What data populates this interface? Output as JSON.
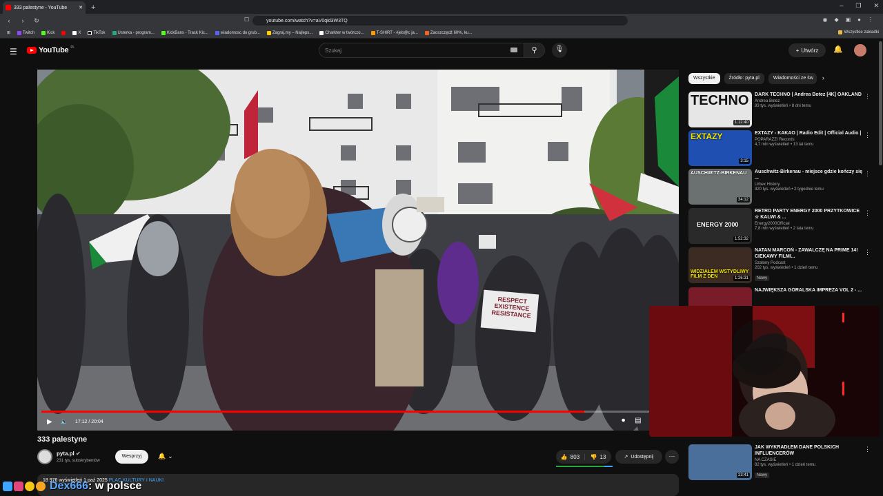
{
  "browser": {
    "tab_title": "333 palestyne - YouTube",
    "url": "youtube.com/watch?v=aV0qid3W3TQ",
    "bookmarks": [
      "Twitch",
      "Kick",
      "X",
      "TikTok",
      "Usterka - program...",
      "KickBans - Track Kic...",
      "wiadomosc do grub...",
      "Zagraj.my – Najleps...",
      "Charkter w twórczo...",
      "T-SHIRT - #jeb@c ja...",
      "Zaoszczędź 60%, ku..."
    ],
    "bookmarks_right": "Wszystkie zakładki"
  },
  "youtube": {
    "logo": "YouTube",
    "region": "PL",
    "search_placeholder": "Szukaj",
    "create_label": "Utwórz"
  },
  "player": {
    "time": "17:12 / 20:04",
    "progress": 0.857,
    "sign_text": [
      "RESPECT",
      "EXISTENCE",
      "RESISTANCE"
    ],
    "sign_text_bound": "RESPECT EXISTENCE RESISTANCE"
  },
  "video": {
    "title": "333 palestyne",
    "channel": "pyta.pl",
    "subscribers": "231 tys. subskrybentów",
    "support_label": "Wesprzyj",
    "likes": "803",
    "dislikes": "13",
    "share_label": "Udostępnij",
    "description_start": "18 976 wyświetleń  1 paź 2025",
    "description_tag": "PLAC KULTURY I NAUKI"
  },
  "chips": [
    "Wszystkie",
    "Źródło: pyta.pl",
    "Wiadomości ze św"
  ],
  "recommendations": [
    {
      "title": "DARK TECHNO | Andrea Botez [4K] OAKLAND",
      "channel": "Andrea Botez",
      "meta": "83 tys. wyświetleń • 8 dni temu",
      "duration": "1:12:40",
      "thumb_text": "TECHNO",
      "thumb_color": "#d9d9d9"
    },
    {
      "title": "EXTAZY - KAKAO | Radio Edit | Official Audio |",
      "channel": "POPARAZZI Records",
      "meta": "4,7 mln wyświetleń • 13 lat temu",
      "duration": "3:15",
      "thumb_text": "EXTAZY",
      "thumb_color": "#1f4fb0"
    },
    {
      "title": "Auschwitz-Birkenau - miejsce gdzie kończy się ...",
      "channel": "Urbex History",
      "meta": "320 tys. wyświetleń • 2 tygodnie temu",
      "duration": "34:12",
      "thumb_text": "AUSCHWITZ-BIRKENAU",
      "thumb_color": "#6b7070"
    },
    {
      "title": "RETRO PARTY ENERGY 2000 PRZYTKOWICE ☆ KALWI & ...",
      "channel": "Energy2000Official",
      "meta": "7,8 mln wyświetleń • 2 lata temu",
      "duration": "1:52:32",
      "thumb_text": "ENERGY 2000",
      "thumb_color": "#2a2a2a"
    },
    {
      "title": "NATAN MARCOŃ - ZAWALCZĘ NA PRIME 14! CIEKAWY FILMI...",
      "channel": "Szalony Podcast",
      "meta": "202 tys. wyświetleń • 1 dzień temu",
      "duration": "1:26:31",
      "thumb_text": "WIDZIAŁEM WSTYDLIWY FILM Z DEN",
      "thumb_color": "#3b2b22",
      "badge": "Nowy"
    },
    {
      "title": "NAJWIĘKSZA GÓRALSKA IMPREZA VOL 2 - ...",
      "channel": "",
      "meta": "",
      "duration": "",
      "thumb_text": "",
      "thumb_color": "#7a1b2a"
    },
    {
      "title": "JAK WYKRADŁEM DANE POLSKICH INFLUENCERÓW",
      "channel": "NA CZASIE",
      "meta": "82 tys. wyświetleń • 1 dzień temu",
      "duration": "23:41",
      "thumb_text": "",
      "thumb_color": "#4a6f9a",
      "badge": "Nowy"
    }
  ],
  "overlay": {
    "name": "Dex666",
    "message": ": w polsce"
  }
}
